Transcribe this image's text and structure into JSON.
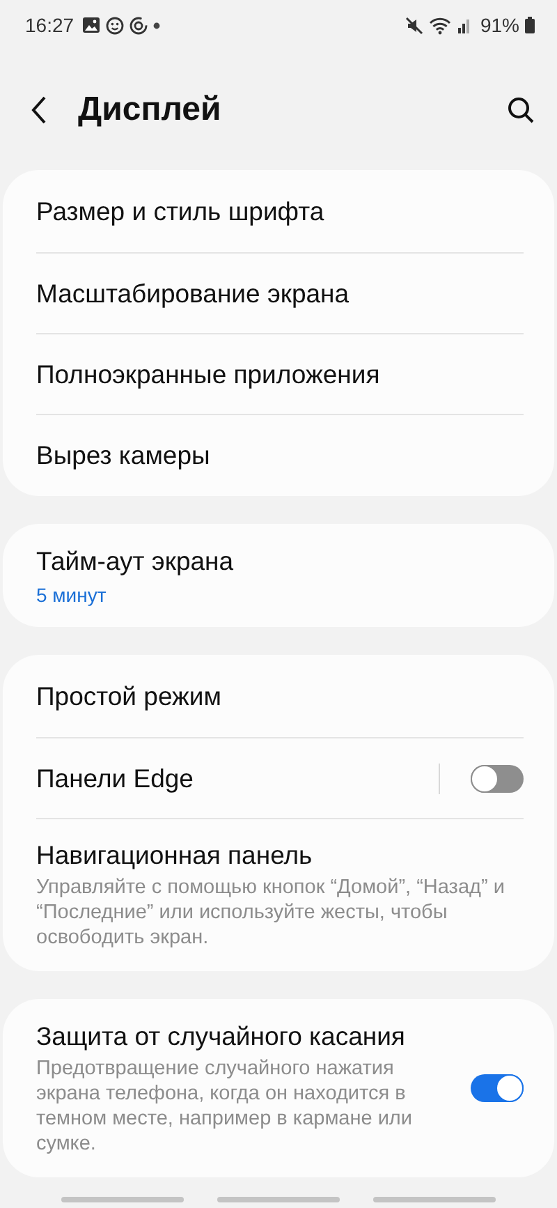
{
  "status_bar": {
    "time": "16:27",
    "battery": "91%"
  },
  "header": {
    "title": "Дисплей"
  },
  "groups": [
    {
      "items": [
        {
          "kind": "plain",
          "title": "Размер и стиль шрифта"
        },
        {
          "kind": "plain",
          "title": "Масштабирование экрана"
        },
        {
          "kind": "plain",
          "title": "Полноэкранные приложения"
        },
        {
          "kind": "plain",
          "title": "Вырез камеры"
        }
      ]
    },
    {
      "items": [
        {
          "kind": "plain",
          "title": "Тайм-аут экрана",
          "value": "5 минут"
        }
      ]
    },
    {
      "items": [
        {
          "kind": "plain",
          "title": "Простой режим"
        },
        {
          "kind": "switch",
          "title": "Панели Edge",
          "on": false,
          "divider": true
        },
        {
          "kind": "plain",
          "title": "Навигационная панель",
          "description": "Управляйте с помощью кнопок “Домой”, “Назад” и “Последние” или используйте жесты, чтобы освободить экран."
        }
      ]
    },
    {
      "items": [
        {
          "kind": "switch",
          "title": "Защита от случайного касания",
          "description": "Предотвращение случайного нажатия экрана телефона, когда он находится в темном месте, например в кармане или сумке.",
          "on": true,
          "divider": false
        }
      ]
    }
  ]
}
